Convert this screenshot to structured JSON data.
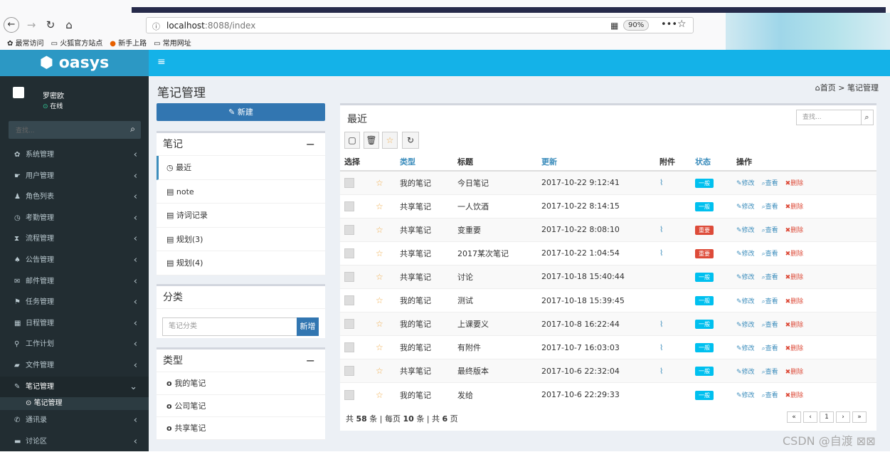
{
  "browser": {
    "url_host": "localhost",
    "url_path": ":8088/index",
    "zoom": "90%",
    "bookmarks": [
      "最常访问",
      "火狐官方站点",
      "新手上路",
      "常用网址"
    ]
  },
  "app": {
    "logo": "oasys",
    "user_name": "罗密欧",
    "user_status": "在线",
    "search_placeholder": "查找..."
  },
  "menu": [
    {
      "label": "系统管理",
      "icon": "gear-icon",
      "glyph": "✿"
    },
    {
      "label": "用户管理",
      "icon": "user-icon",
      "glyph": "☛"
    },
    {
      "label": "角色列表",
      "icon": "person-icon",
      "glyph": "♟"
    },
    {
      "label": "考勤管理",
      "icon": "clock-icon",
      "glyph": "◷"
    },
    {
      "label": "流程管理",
      "icon": "hourglass-icon",
      "glyph": "⧗"
    },
    {
      "label": "公告管理",
      "icon": "bell-icon",
      "glyph": "♠"
    },
    {
      "label": "邮件管理",
      "icon": "mail-icon",
      "glyph": "✉"
    },
    {
      "label": "任务管理",
      "icon": "flag-icon",
      "glyph": "⚑"
    },
    {
      "label": "日程管理",
      "icon": "calendar-icon",
      "glyph": "▦"
    },
    {
      "label": "工作计划",
      "icon": "plan-icon",
      "glyph": "⚲"
    },
    {
      "label": "文件管理",
      "icon": "folder-icon",
      "glyph": "▰"
    },
    {
      "label": "笔记管理",
      "icon": "edit-icon",
      "glyph": "✎"
    },
    {
      "label": "通讯录",
      "icon": "phone-icon",
      "glyph": "✆"
    },
    {
      "label": "讨论区",
      "icon": "comment-icon",
      "glyph": "▬"
    }
  ],
  "submenu_label": "笔记管理",
  "page": {
    "title": "笔记管理",
    "crumb_home": "首页",
    "crumb_current": "笔记管理",
    "new_button": "新建"
  },
  "notes_box": {
    "title": "笔记",
    "items": [
      "最近",
      "note",
      "诗词记录",
      "规划(3)",
      "规划(4)"
    ]
  },
  "category_box": {
    "title": "分类",
    "input_placeholder": "笔记分类",
    "add_button": "新增"
  },
  "type_box": {
    "title": "类型",
    "items": [
      "我的笔记",
      "公司笔记",
      "共享笔记"
    ]
  },
  "main": {
    "title": "最近",
    "search_placeholder": "查找...",
    "headers": [
      "选择",
      "",
      "类型",
      "标题",
      "更新",
      "附件",
      "状态",
      "操作"
    ],
    "actions": {
      "edit": "修改",
      "view": "查看",
      "delete": "删除"
    },
    "rows": [
      {
        "type": "我的笔记",
        "title": "今日笔记",
        "updated": "2017-10-22 9:12:41",
        "attach": true,
        "status": "一般",
        "status_color": "#00c0ef"
      },
      {
        "type": "共享笔记",
        "title": "一人饮酒",
        "updated": "2017-10-22 8:14:15",
        "attach": false,
        "status": "一般",
        "status_color": "#00c0ef"
      },
      {
        "type": "共享笔记",
        "title": "变重要",
        "updated": "2017-10-22 8:08:10",
        "attach": true,
        "status": "重要",
        "status_color": "#dd4b39"
      },
      {
        "type": "共享笔记",
        "title": "2017某次笔记",
        "updated": "2017-10-22 1:04:54",
        "attach": true,
        "status": "重要",
        "status_color": "#dd4b39"
      },
      {
        "type": "共享笔记",
        "title": "讨论",
        "updated": "2017-10-18 15:40:44",
        "attach": false,
        "status": "一般",
        "status_color": "#00c0ef"
      },
      {
        "type": "我的笔记",
        "title": "测试",
        "updated": "2017-10-18 15:39:45",
        "attach": false,
        "status": "一般",
        "status_color": "#00c0ef"
      },
      {
        "type": "我的笔记",
        "title": "上课要义",
        "updated": "2017-10-8 16:22:44",
        "attach": true,
        "status": "一般",
        "status_color": "#00c0ef"
      },
      {
        "type": "我的笔记",
        "title": "有附件",
        "updated": "2017-10-7 16:03:03",
        "attach": true,
        "status": "一般",
        "status_color": "#00c0ef"
      },
      {
        "type": "共享笔记",
        "title": "最终版本",
        "updated": "2017-10-6 22:32:04",
        "attach": true,
        "status": "一般",
        "status_color": "#00c0ef"
      },
      {
        "type": "我的笔记",
        "title": "发给",
        "updated": "2017-10-6 22:29:33",
        "attach": false,
        "status": "一般",
        "status_color": "#00c0ef"
      }
    ],
    "footer": {
      "total": "58",
      "per_page": "10",
      "pages": "6"
    },
    "current_page": "1"
  },
  "watermark": "CSDN @自渡 ⊠⊠"
}
